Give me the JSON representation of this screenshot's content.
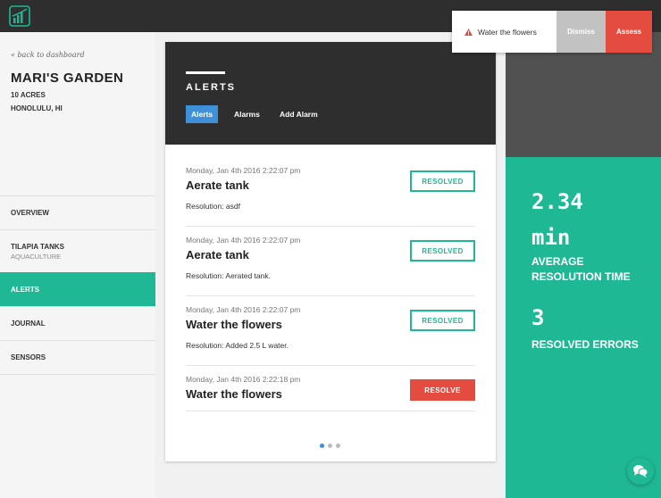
{
  "header": {
    "logo": "growth-chart-logo-icon"
  },
  "sidebar": {
    "back_link": "« back to dashboard",
    "title": "MARI'S GARDEN",
    "acres": "10 ACRES",
    "location": "HONOLULU, HI",
    "nav": [
      {
        "label": "OVERVIEW",
        "sub": ""
      },
      {
        "label": "TILAPIA TANKS",
        "sub": "AQUACULTURE"
      },
      {
        "label": "ALERTS",
        "sub": "",
        "active": true
      },
      {
        "label": "JOURNAL",
        "sub": ""
      },
      {
        "label": "SENSORS",
        "sub": ""
      }
    ]
  },
  "alerts_card": {
    "title": "ALERTS",
    "tabs": [
      {
        "label": "Alerts",
        "active": true
      },
      {
        "label": "Alarms",
        "active": false
      },
      {
        "label": "Add Alarm",
        "active": false
      }
    ],
    "items": [
      {
        "date": "Monday, Jan 4th 2016 2:22:07 pm",
        "name": "Aerate tank",
        "resolution": "Resolution: asdf",
        "status": "RESOLVED"
      },
      {
        "date": "Monday, Jan 4th 2016 2:22:07 pm",
        "name": "Aerate tank",
        "resolution": "Resolution: Aerated tank.",
        "status": "RESOLVED"
      },
      {
        "date": "Monday, Jan 4th 2016 2:22:07 pm",
        "name": "Water the flowers",
        "resolution": "Resolution: Added 2.5 L water.",
        "status": "RESOLVED"
      },
      {
        "date": "Monday, Jan 4th 2016 2:22:18 pm",
        "name": "Water the flowers",
        "resolution": "",
        "status": "RESOLVE"
      }
    ],
    "pagination": {
      "pages": 3,
      "current": 1
    }
  },
  "stats": {
    "avg_time_value": "2.34",
    "avg_time_unit": "min",
    "avg_time_label_1": "AVERAGE",
    "avg_time_label_2": "RESOLUTION TIME",
    "resolved_count": "3",
    "resolved_label": "RESOLVED ERRORS"
  },
  "notification": {
    "icon": "warning-icon",
    "message": "Water the flowers",
    "dismiss_label": "Dismiss",
    "assess_label": "Assess"
  },
  "chat": {
    "icon": "chat-bubbles-icon"
  },
  "colors": {
    "accent_teal": "#1fb894",
    "tab_blue": "#3e90d8",
    "alert_red": "#e34c3e",
    "dark": "#2e2e2e"
  }
}
